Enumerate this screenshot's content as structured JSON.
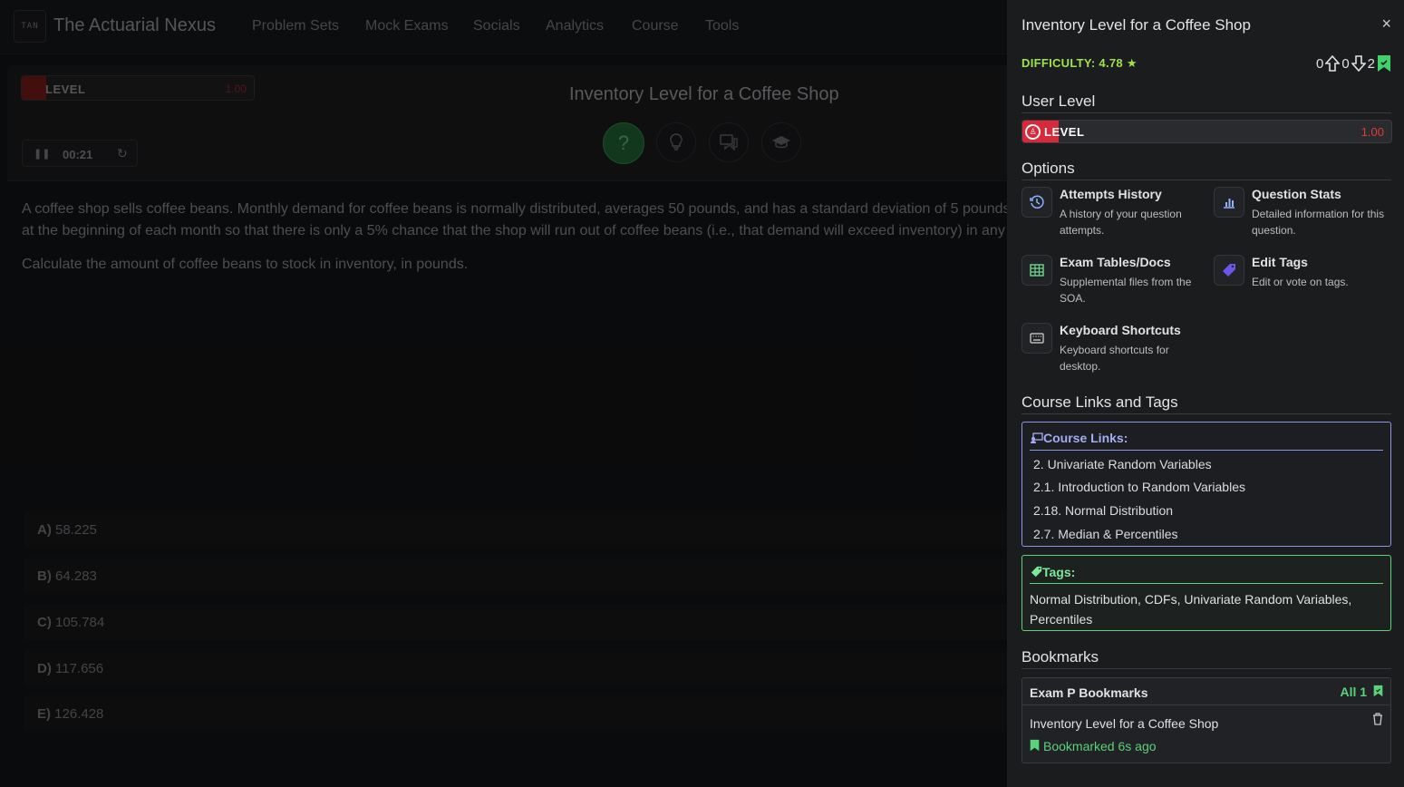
{
  "app": {
    "logo": "TAN",
    "brand": "The Actuarial Nexus",
    "nav": [
      "Problem Sets",
      "Mock Exams",
      "Socials",
      "Analytics",
      "Course",
      "Tools"
    ]
  },
  "question": {
    "level_label": "LEVEL",
    "level_value": "1.00",
    "timer": "00:21",
    "title": "Inventory Level for a Coffee Shop",
    "text_line1": "A coffee shop sells coffee beans. Monthly demand for coffee beans is normally distributed, averages 50 pounds, and has a standard deviation of 5 pounds.",
    "text_line2": "at the beginning of each month so that there is only a 5% chance that the shop will run out of coffee beans (i.e., that demand will exceed inventory) in any",
    "text_prompt": "Calculate the amount of coffee beans to stock in inventory, in pounds.",
    "answers": [
      {
        "letter": "A)",
        "value": "58.225"
      },
      {
        "letter": "B)",
        "value": "64.283"
      },
      {
        "letter": "C)",
        "value": "105.784"
      },
      {
        "letter": "D)",
        "value": "117.656"
      },
      {
        "letter": "E)",
        "value": "126.428"
      }
    ]
  },
  "panel": {
    "title": "Inventory Level for a Coffee Shop",
    "close": "×",
    "difficulty": "DIFFICULTY: 4.78",
    "upvotes": "0",
    "downvotes": "0",
    "bookmarks": "2",
    "user_level_heading": "User Level",
    "level_label": "LEVEL",
    "level_value": "1.00",
    "options_heading": "Options",
    "options": [
      {
        "title": "Attempts History",
        "desc": "A history of your question attempts."
      },
      {
        "title": "Question Stats",
        "desc": "Detailed information for this question."
      },
      {
        "title": "Exam Tables/Docs",
        "desc": "Supplemental files from the SOA."
      },
      {
        "title": "Edit Tags",
        "desc": "Edit or vote on tags."
      },
      {
        "title": "Keyboard Shortcuts",
        "desc": "Keyboard shortcuts for desktop."
      }
    ],
    "course_heading": "Course Links and Tags",
    "course_links_label": "Course Links:",
    "course_links": [
      "2. Univariate Random Variables",
      "2.1. Introduction to Random Variables",
      "2.18. Normal Distribution",
      "2.7. Median & Percentiles"
    ],
    "tags_label": "Tags:",
    "tags": "Normal Distribution, CDFs, Univariate Random Variables, Percentiles",
    "bookmarks_heading": "Bookmarks",
    "bookmark_list_title": "Exam P Bookmarks",
    "bookmark_all": "All 1",
    "bookmark_item": "Inventory Level for a Coffee Shop",
    "bookmark_when": "Bookmarked 6s ago"
  },
  "colors": {
    "difficulty": "#9ee34a",
    "level_badge": "#d8283a",
    "course_links_border": "#8e95e8",
    "tags_border": "#5ad27a"
  }
}
